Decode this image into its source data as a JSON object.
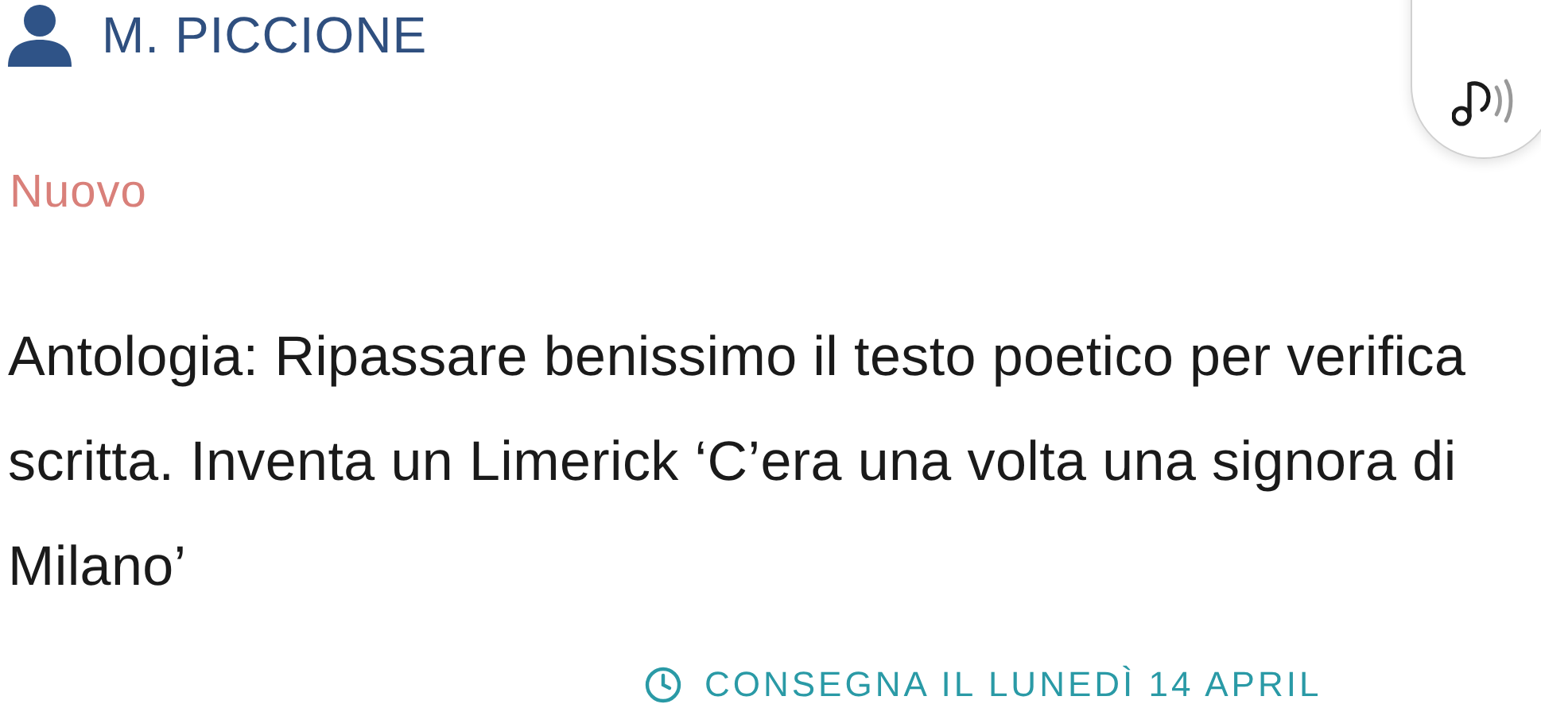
{
  "teacher": {
    "name": "M. PICCIONE"
  },
  "status": "Nuovo",
  "description": "Antologia: Ripassare benissimo il testo poetico per verifica scritta. Inventa un Limerick ‘C’era una volta una signora di Milano’",
  "due": "CONSEGNA IL LUNEDÌ 14 APRIL"
}
